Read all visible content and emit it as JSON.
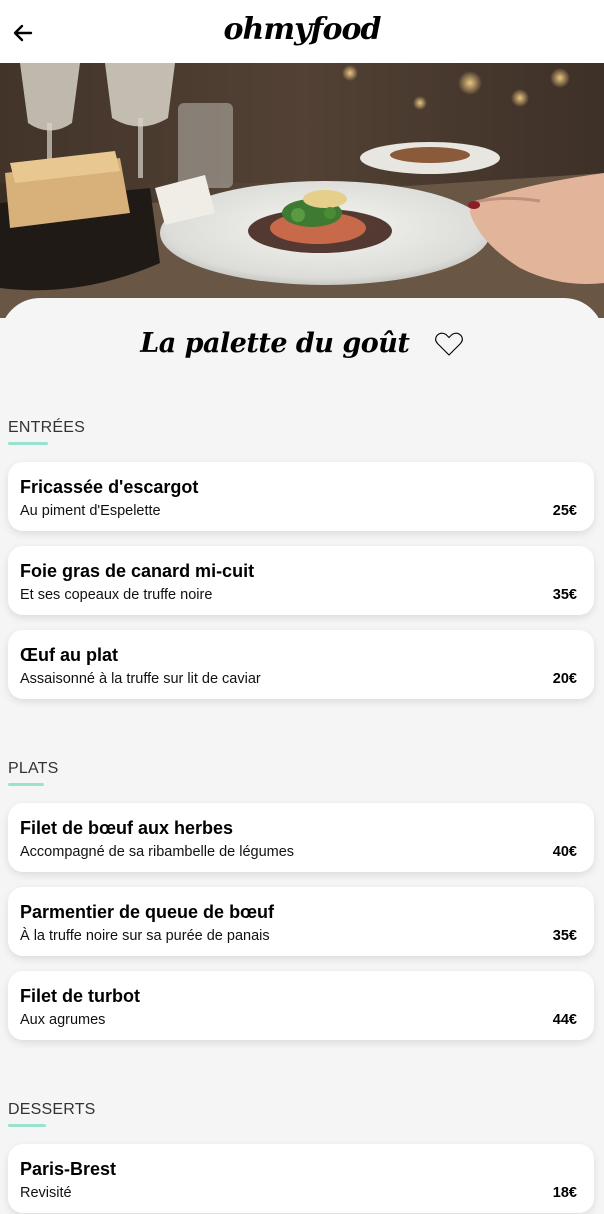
{
  "header": {
    "logo": "ohmyfood",
    "back_icon": "arrow-left-icon"
  },
  "hero": {
    "image_alt": "restaurant-dish-photo"
  },
  "restaurant": {
    "name": "La palette du goût",
    "like_icon": "heart-icon"
  },
  "colors": {
    "accent": "#99e2d0",
    "background": "#f5f5f5",
    "card": "#ffffff"
  },
  "menu": [
    {
      "title": "ENTRÉES",
      "dishes": [
        {
          "name": "Fricassée d'escargot",
          "description": "Au piment d'Espelette",
          "price": "25€"
        },
        {
          "name": "Foie gras de canard mi-cuit",
          "description": "Et ses copeaux de truffe noire",
          "price": "35€"
        },
        {
          "name": "Œuf au plat",
          "description": "Assaisonné à la truffe sur lit de caviar",
          "price": "20€"
        }
      ]
    },
    {
      "title": "PLATS",
      "dishes": [
        {
          "name": "Filet de bœuf aux herbes",
          "description": "Accompagné de sa ribambelle de légumes",
          "price": "40€"
        },
        {
          "name": "Parmentier de queue de bœuf",
          "description": "À la truffe noire sur sa purée de panais",
          "price": "35€"
        },
        {
          "name": "Filet de turbot",
          "description": "Aux agrumes",
          "price": "44€"
        }
      ]
    },
    {
      "title": "DESSERTS",
      "dishes": [
        {
          "name": "Paris-Brest",
          "description": "Revisité",
          "price": "18€"
        }
      ]
    }
  ]
}
